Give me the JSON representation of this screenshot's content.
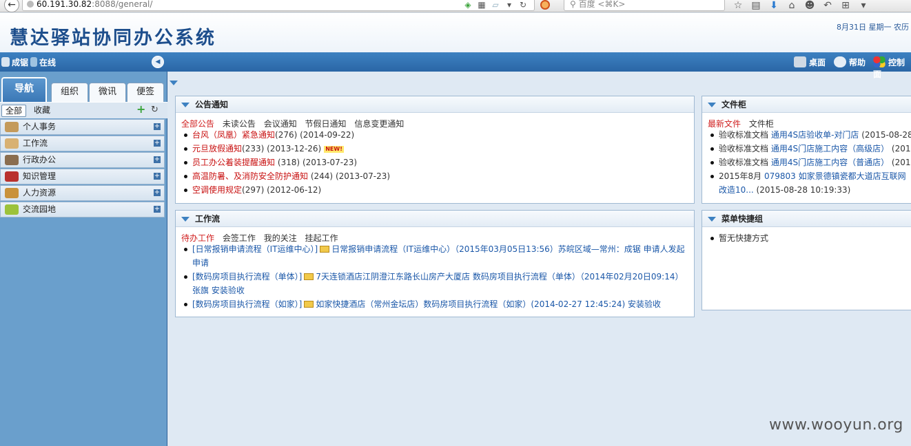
{
  "browser": {
    "url_host": "60.191.30.82",
    "url_rest": ":8088/general/",
    "search_placeholder": "百度 <⌘K>"
  },
  "header": {
    "title": "慧达驿站协同办公系统",
    "date": "8月31日 星期一 农历"
  },
  "userbar": {
    "user": "成锯",
    "status": "在线",
    "desktop": "桌面",
    "help": "帮助",
    "control": "控制面"
  },
  "sidebar": {
    "tabs": [
      "导航",
      "组织",
      "微讯",
      "便签"
    ],
    "subtabs": [
      "全部",
      "收藏"
    ],
    "menu": [
      {
        "label": "个人事务",
        "color": "#c49a5a"
      },
      {
        "label": "工作流",
        "color": "#d8b173"
      },
      {
        "label": "行政办公",
        "color": "#8a6d4f"
      },
      {
        "label": "知识管理",
        "color": "#b9312d"
      },
      {
        "label": "人力资源",
        "color": "#c9923b"
      },
      {
        "label": "交流园地",
        "color": "#9cc23a"
      }
    ]
  },
  "announce": {
    "title": "公告通知",
    "tabs": [
      "全部公告",
      "未读公告",
      "会议通知",
      "节假日通知",
      "信息变更通知"
    ],
    "items": [
      {
        "title": "台风（凤凰）紧急通知",
        "count": "(276)",
        "date": "(2014-09-22)",
        "badge": ""
      },
      {
        "title": "元旦放假通知",
        "count": "(233)",
        "date": "(2013-12-26)",
        "badge": "NEW!"
      },
      {
        "title": "员工办公着装提醒通知",
        "count": " (318)",
        "date": "(2013-07-23)",
        "badge": ""
      },
      {
        "title": "高温防暑、及消防安全防护通知",
        "count": " (244)",
        "date": "(2013-07-23)",
        "badge": ""
      },
      {
        "title": "空调使用规定",
        "count": "(297)",
        "date": "(2012-06-12)",
        "badge": ""
      }
    ]
  },
  "workflow": {
    "title": "工作流",
    "tabs": [
      "待办工作",
      "会签工作",
      "我的关注",
      "挂起工作"
    ],
    "items": [
      {
        "flow": "[日常报销申请流程（IT运维中心）]",
        "text": "日常报销申请流程（IT运维中心）（2015年03月05日13:56）苏皖区域—常州：成锯 申请人发起申请"
      },
      {
        "flow": "[数码房项目执行流程（单体）]",
        "text": "7天连锁酒店江阴澄江东路长山房产大厦店 数码房项目执行流程（单体）（2014年02月20日09:14）张旗 安装验收"
      },
      {
        "flow": "[数码房项目执行流程（如家）]",
        "text": "如家快捷酒店（常州金坛店）数码房项目执行流程（如家）(2014-02-27 12:45:24) 安装验收"
      }
    ]
  },
  "filecab": {
    "title": "文件柜",
    "tabs": [
      "最新文件",
      "文件柜"
    ],
    "items": [
      {
        "prefix": "验收标准文档 ",
        "link": "通用4S店验收单-对门店",
        "date": " (2015-08-28 1"
      },
      {
        "prefix": "验收标准文档 ",
        "link": "通用4S门店施工内容（高级店）",
        "date": " (2015"
      },
      {
        "prefix": "验收标准文档 ",
        "link": "通用4S门店施工内容（普通店）",
        "date": " (2015"
      },
      {
        "prefix": "2015年8月 ",
        "link": "079803 如家景德镇瓷都大道店互联网改造10...",
        "date": " (2015-08-28 10:19:33)"
      }
    ]
  },
  "shortcuts": {
    "title": "菜单快捷组",
    "items": [
      "暂无快捷方式"
    ]
  },
  "watermark": "www.wooyun.org"
}
